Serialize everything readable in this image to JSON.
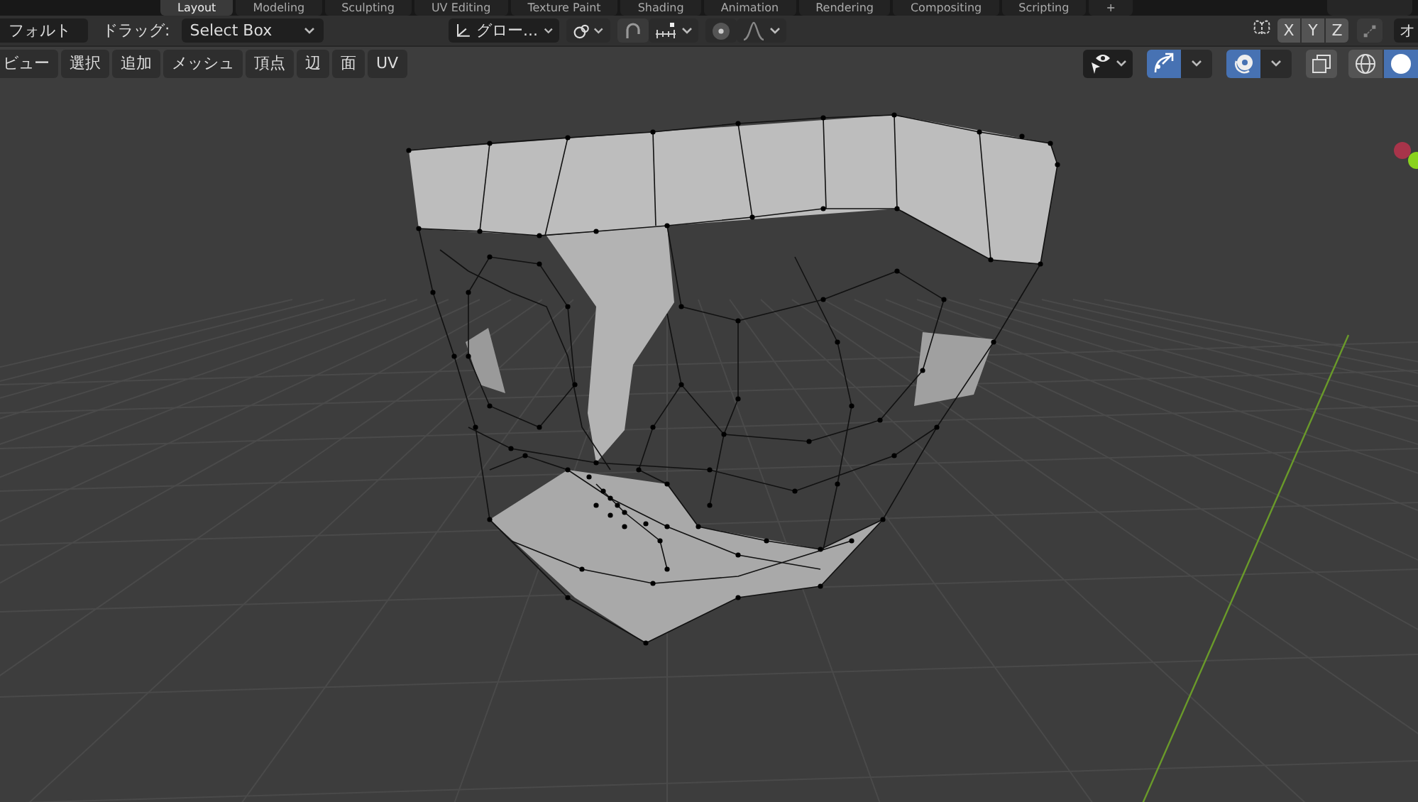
{
  "workspace_tabs": [
    {
      "label": "Layout",
      "selected": true
    },
    {
      "label": "Modeling",
      "selected": false
    },
    {
      "label": "Sculpting",
      "selected": false
    },
    {
      "label": "UV Editing",
      "selected": false
    },
    {
      "label": "Texture Paint",
      "selected": false
    },
    {
      "label": "Shading",
      "selected": false
    },
    {
      "label": "Animation",
      "selected": false
    },
    {
      "label": "Rendering",
      "selected": false
    },
    {
      "label": "Compositing",
      "selected": false
    },
    {
      "label": "Scripting",
      "selected": false
    },
    {
      "label": "+",
      "selected": false
    }
  ],
  "tool_header": {
    "preset": "フォルト",
    "drag_label": "ドラッグ:",
    "drag_value": "Select Box",
    "orientation": "グロー...",
    "snap_on": false,
    "mirror_axes": [
      {
        "label": "X",
        "selected": false
      },
      {
        "label": "Y",
        "selected": false
      },
      {
        "label": "Z",
        "selected": false
      }
    ],
    "options_cut": "オ"
  },
  "viewport_menus": [
    "ビュー",
    "選択",
    "追加",
    "メッシュ",
    "頂点",
    "辺",
    "面",
    "UV"
  ],
  "viewport_toggles": {
    "gizmos_on": true,
    "overlays_on": true,
    "xray_on": false
  },
  "shading_modes": [
    {
      "kind": "wireframe",
      "selected": false
    },
    {
      "kind": "solid",
      "selected": true
    }
  ]
}
